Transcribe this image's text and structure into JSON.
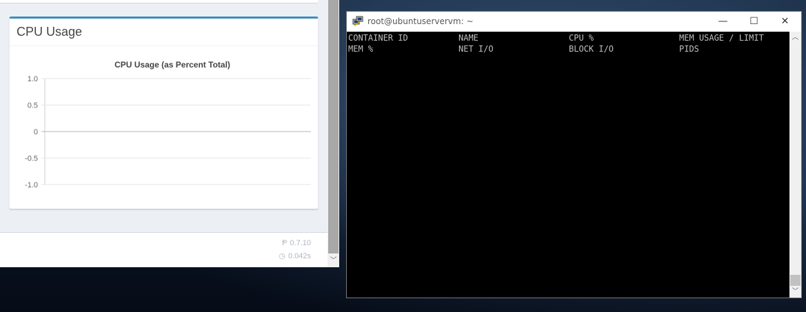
{
  "browser": {
    "card": {
      "title": "CPU Usage"
    },
    "footer": {
      "version_icon": "product-hunt-icon",
      "version": "0.7.10",
      "time_icon": "clock-icon",
      "time": "0.042s"
    }
  },
  "chart_data": {
    "type": "line",
    "title": "CPU Usage (as Percent Total)",
    "xlabel": "",
    "ylabel": "",
    "x": [],
    "series": [],
    "yticks": [
      "1.0",
      "0.5",
      "0",
      "-0.5",
      "-1.0"
    ],
    "ytick_values": [
      1.0,
      0.5,
      0,
      -0.5,
      -1.0
    ],
    "ylim": [
      -1.0,
      1.0
    ],
    "grid": true,
    "colors": {
      "grid": "#e6e6e6",
      "zero_line": "#b3b3b3",
      "axis": "#cccccc",
      "tick_text": "#666666",
      "title_text": "#444444"
    }
  },
  "terminal": {
    "title": "root@ubuntuservervm: ~",
    "app_icon": "putty-icon",
    "controls": {
      "minimize": "—",
      "maximize": "☐",
      "close": "✕"
    },
    "headers_row1": [
      "CONTAINER ID",
      "NAME",
      "CPU %",
      "MEM USAGE / LIMIT"
    ],
    "headers_row2": [
      "MEM %",
      "NET I/O",
      "BLOCK I/O",
      "PIDS"
    ]
  },
  "colors": {
    "accent": "#3c8dbc",
    "terminal_bg": "#000000",
    "terminal_text": "#c0c0c0"
  }
}
